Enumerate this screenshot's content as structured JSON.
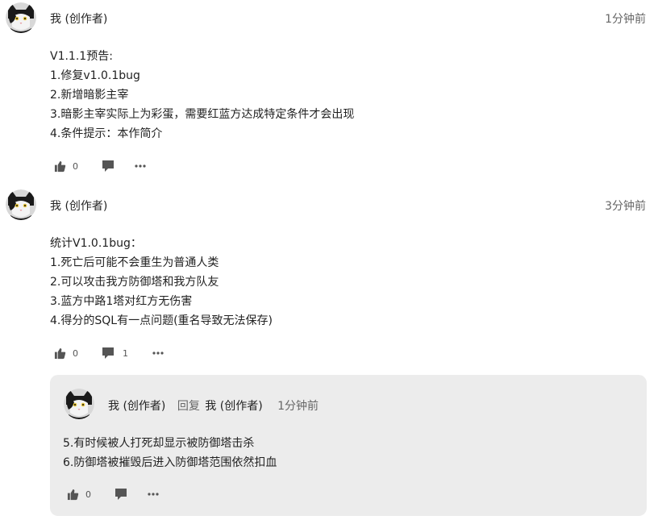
{
  "comments": [
    {
      "author": "我 (创作者)",
      "time": "1分钟前",
      "lines": [
        "V1.1.1预告:",
        "1.修复v1.0.1bug",
        "2.新增暗影主宰",
        "3.暗影主宰实际上为彩蛋，需要红蓝方达成特定条件才会出现",
        "4.条件提示：本作简介"
      ],
      "likes": "0",
      "replies": ""
    },
    {
      "author": "我 (创作者)",
      "time": "3分钟前",
      "lines": [
        "统计V1.0.1bug：",
        "1.死亡后可能不会重生为普通人类",
        "2.可以攻击我方防御塔和我方队友",
        "3.蓝方中路1塔对红方无伤害",
        "4.得分的SQL有一点问题(重名导致无法保存)"
      ],
      "likes": "0",
      "replies": "1"
    }
  ],
  "reply": {
    "author": "我 (创作者)",
    "reply_word": "回复",
    "target": "我 (创作者)",
    "time": "1分钟前",
    "lines": [
      "5.有时候被人打死却显示被防御塔击杀",
      "6.防御塔被摧毁后进入防御塔范围依然扣血"
    ],
    "likes": "0"
  },
  "icons": {
    "like": "thumbs-up-icon",
    "comment": "speech-bubble-icon",
    "more": "more-dots-icon",
    "avatar": "cat-avatar"
  }
}
